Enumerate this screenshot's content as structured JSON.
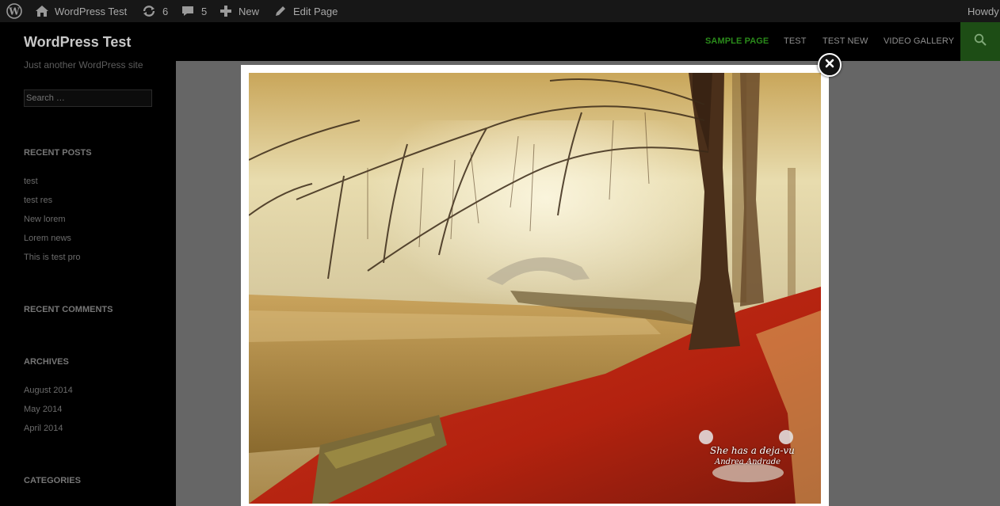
{
  "adminbar": {
    "wp_logo_icon": "wordpress-logo-icon",
    "site_name": "WordPress Test",
    "updates_count": "6",
    "comments_count": "5",
    "new_label": "New",
    "edit_label": "Edit Page",
    "howdy": "Howdy"
  },
  "header": {
    "site_title": "WordPress Test",
    "nav": [
      "SAMPLE PAGE",
      "TEST",
      "TEST NEW",
      "VIDEO GALLERY"
    ],
    "accent_color": "#2a8a1a",
    "search_icon": "search-icon"
  },
  "sidebar": {
    "tagline": "Just another WordPress site",
    "search_placeholder": "Search …",
    "recent_posts_title": "RECENT POSTS",
    "recent_posts": [
      "test",
      "test res",
      "New lorem",
      "Lorem news",
      "This is test pro"
    ],
    "recent_comments_title": "RECENT COMMENTS",
    "archives_title": "ARCHIVES",
    "archives": [
      "August 2014",
      "May 2014",
      "April 2014"
    ],
    "categories_title": "CATEGORIES"
  },
  "lightbox": {
    "close_icon": "close-icon",
    "watermark_line1": "She has a deja-vu",
    "watermark_line2": "Andrea Andrade"
  }
}
